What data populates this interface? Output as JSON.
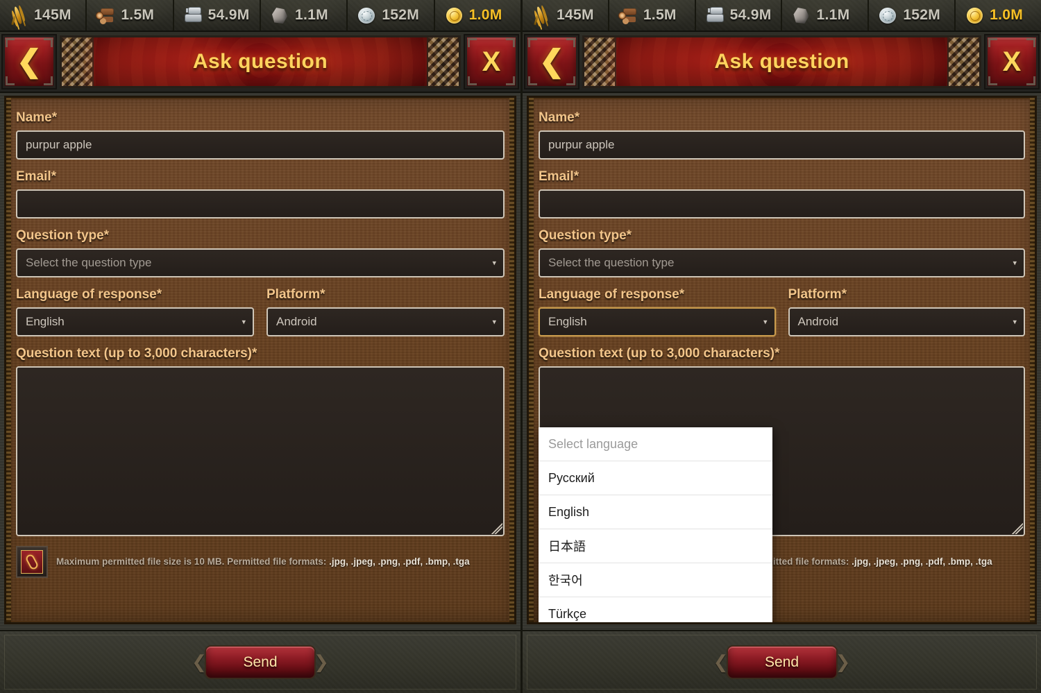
{
  "resources": [
    {
      "icon": "wheat-icon",
      "name": "wheat",
      "value": "145M",
      "gold": false
    },
    {
      "icon": "wood-icon",
      "name": "wood",
      "value": "1.5M",
      "gold": false
    },
    {
      "icon": "iron-icon",
      "name": "iron",
      "value": "54.9M",
      "gold": false
    },
    {
      "icon": "stone-icon",
      "name": "stone",
      "value": "1.1M",
      "gold": false
    },
    {
      "icon": "silver-icon",
      "name": "silver",
      "value": "152M",
      "gold": false
    },
    {
      "icon": "gold-icon",
      "name": "gold",
      "value": "1.0M",
      "gold": true
    }
  ],
  "header": {
    "title": "Ask question",
    "back_glyph": "❮",
    "close_glyph": "X"
  },
  "form": {
    "name_label": "Name*",
    "name_value": "purpur apple",
    "email_label": "Email*",
    "email_value": "",
    "question_type_label": "Question type*",
    "question_type_value": "Select the question type",
    "language_label": "Language of response*",
    "language_value": "English",
    "platform_label": "Platform*",
    "platform_value": "Android",
    "question_text_label": "Question text (up to 3,000 characters)*",
    "question_text_value": "",
    "caret_glyph": "▾"
  },
  "attachment": {
    "icon": "paperclip-icon",
    "note": "Maximum permitted file size is 10 MB. Permitted file formats:",
    "formats": ".jpg, .jpeg, .png, .pdf, .bmp, .tga"
  },
  "footer": {
    "send_label": "Send",
    "ornament_left": "❮",
    "ornament_right": "❯"
  },
  "language_dropdown": {
    "open": true,
    "options": [
      {
        "label": "Select language",
        "placeholder": true
      },
      {
        "label": "Русский",
        "placeholder": false
      },
      {
        "label": "English",
        "placeholder": false
      },
      {
        "label": "日本語",
        "placeholder": false
      },
      {
        "label": "한국어",
        "placeholder": false
      },
      {
        "label": "Türkçe",
        "placeholder": false
      }
    ]
  },
  "colors": {
    "panel_brown": "#66401f",
    "label_gold": "#f2c58a",
    "title_gold": "#ffd45e",
    "accent_red": "#8c1b24",
    "gold_value": "#f6c026"
  }
}
